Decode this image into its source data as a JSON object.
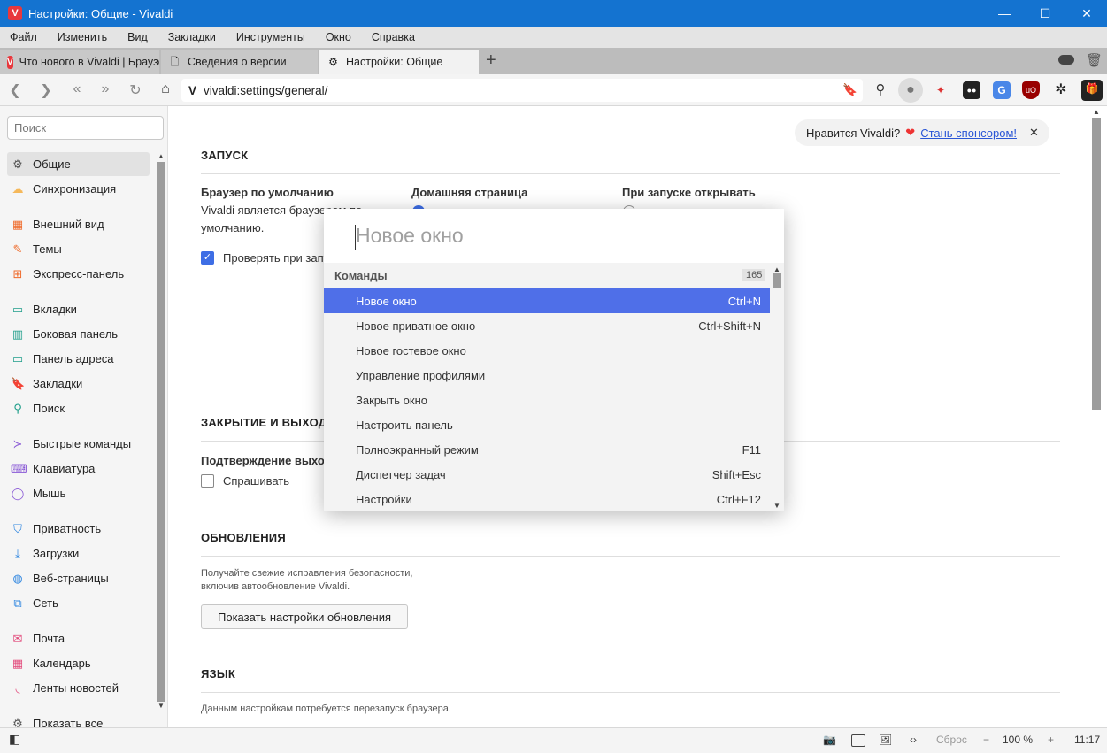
{
  "window": {
    "title": "Настройки: Общие - Vivaldi",
    "minimize": "—",
    "maximize": "☐",
    "close": "✕"
  },
  "menu": [
    "Файл",
    "Изменить",
    "Вид",
    "Закладки",
    "Инструменты",
    "Окно",
    "Справка"
  ],
  "tabs": [
    {
      "label": "Что нового в Vivaldi | Браузер"
    },
    {
      "label": "Сведения о версии"
    },
    {
      "label": "Настройки: Общие"
    }
  ],
  "address": {
    "url": "vivaldi:settings/general/"
  },
  "sidebar": {
    "search_placeholder": "Поиск",
    "items": [
      {
        "label": "Общие",
        "icon": "general-icon",
        "color": "#555555"
      },
      {
        "label": "Синхронизация",
        "icon": "cloud-icon",
        "color": "#f5b85a"
      },
      {
        "label": "Внешний вид",
        "icon": "appearance-icon",
        "color": "#ef6a2a"
      },
      {
        "label": "Темы",
        "icon": "brush-icon",
        "color": "#ef6a2a"
      },
      {
        "label": "Экспресс-панель",
        "icon": "speed-dial-icon",
        "color": "#ef6a2a"
      },
      {
        "label": "Вкладки",
        "icon": "tabs-icon",
        "color": "#1f9e8a"
      },
      {
        "label": "Боковая панель",
        "icon": "panel-icon",
        "color": "#1f9e8a"
      },
      {
        "label": "Панель адреса",
        "icon": "address-bar-icon",
        "color": "#1f9e8a"
      },
      {
        "label": "Закладки",
        "icon": "bookmark-icon",
        "color": "#1f9e8a"
      },
      {
        "label": "Поиск",
        "icon": "search-icon",
        "color": "#1f9e8a"
      },
      {
        "label": "Быстрые команды",
        "icon": "quick-commands-icon",
        "color": "#8a5ad6"
      },
      {
        "label": "Клавиатура",
        "icon": "keyboard-icon",
        "color": "#8a5ad6"
      },
      {
        "label": "Мышь",
        "icon": "mouse-icon",
        "color": "#8a5ad6"
      },
      {
        "label": "Приватность",
        "icon": "shield-icon",
        "color": "#2f86e0"
      },
      {
        "label": "Загрузки",
        "icon": "download-icon",
        "color": "#2f86e0"
      },
      {
        "label": "Веб-страницы",
        "icon": "globe-icon",
        "color": "#2f86e0"
      },
      {
        "label": "Сеть",
        "icon": "network-icon",
        "color": "#2f86e0"
      },
      {
        "label": "Почта",
        "icon": "mail-icon",
        "color": "#e2487a"
      },
      {
        "label": "Календарь",
        "icon": "calendar-icon",
        "color": "#e2487a"
      },
      {
        "label": "Ленты новостей",
        "icon": "feed-icon",
        "color": "#e2487a"
      },
      {
        "label": "Показать все",
        "icon": "gear-icon",
        "color": "#555555"
      }
    ]
  },
  "sponsor": {
    "text": "Нравится Vivaldi?",
    "link": "Стань спонсором!"
  },
  "settings": {
    "startup": {
      "title": "ЗАПУСК",
      "default_browser_label": "Браузер по умолчанию",
      "default_browser_text1": "Vivaldi является браузером по",
      "default_browser_text2": "умолчанию.",
      "check_on_start": "Проверять при запуске",
      "homepage_label": "Домашняя страница",
      "on_start_label": "При запуске открывать"
    },
    "exit": {
      "title": "ЗАКРЫТИЕ И ВЫХОД",
      "confirm_label": "Подтверждение выхода",
      "ask": "Спрашивать"
    },
    "updates": {
      "title": "ОБНОВЛЕНИЯ",
      "text1": "Получайте свежие исправления безопасности,",
      "text2": "включив автообновление Vivaldi.",
      "button": "Показать настройки обновления"
    },
    "language": {
      "title": "ЯЗЫК",
      "text": "Данным настройкам потребуется перезапуск браузера."
    }
  },
  "quick_commands": {
    "placeholder": "Новое окно",
    "section": "Команды",
    "count": "165",
    "items": [
      {
        "label": "Новое окно",
        "key": "Ctrl+N"
      },
      {
        "label": "Новое приватное окно",
        "key": "Ctrl+Shift+N"
      },
      {
        "label": "Новое гостевое окно",
        "key": ""
      },
      {
        "label": "Управление профилями",
        "key": ""
      },
      {
        "label": "Закрыть окно",
        "key": ""
      },
      {
        "label": "Настроить панель",
        "key": ""
      },
      {
        "label": "Полноэкранный режим",
        "key": "F11"
      },
      {
        "label": "Диспетчер задач",
        "key": "Shift+Esc"
      },
      {
        "label": "Настройки",
        "key": "Ctrl+F12"
      }
    ]
  },
  "status": {
    "reset": "Сброс",
    "zoom": "100 %",
    "time": "11:17"
  },
  "colors": {
    "accent": "#4f6fe8",
    "titlebar": "#1473d0"
  }
}
